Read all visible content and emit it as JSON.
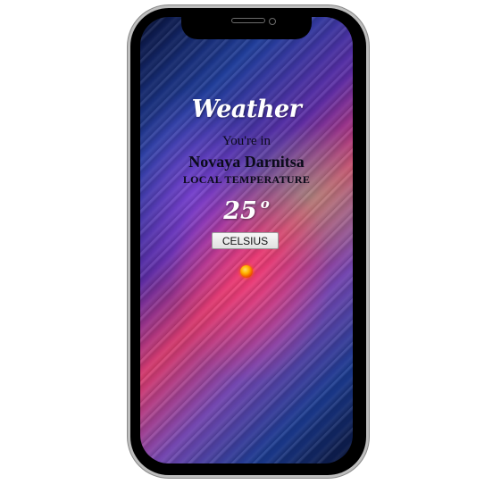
{
  "app": {
    "title": "Weather",
    "location_prefix": "You're in",
    "city": "Novaya Darnitsa",
    "temperature_label": "LOCAL TEMPERATURE",
    "temperature_value": "25",
    "temperature_unit_symbol": "o",
    "unit_button_label": "CELSIUS",
    "weather_icon": "sun-icon"
  },
  "colors": {
    "title_text": "#ffffff",
    "body_text": "#0b0b1a",
    "phone_frame": "#000000",
    "phone_bezel": "#bdbdbd",
    "sun_icon": "#f05a00"
  }
}
